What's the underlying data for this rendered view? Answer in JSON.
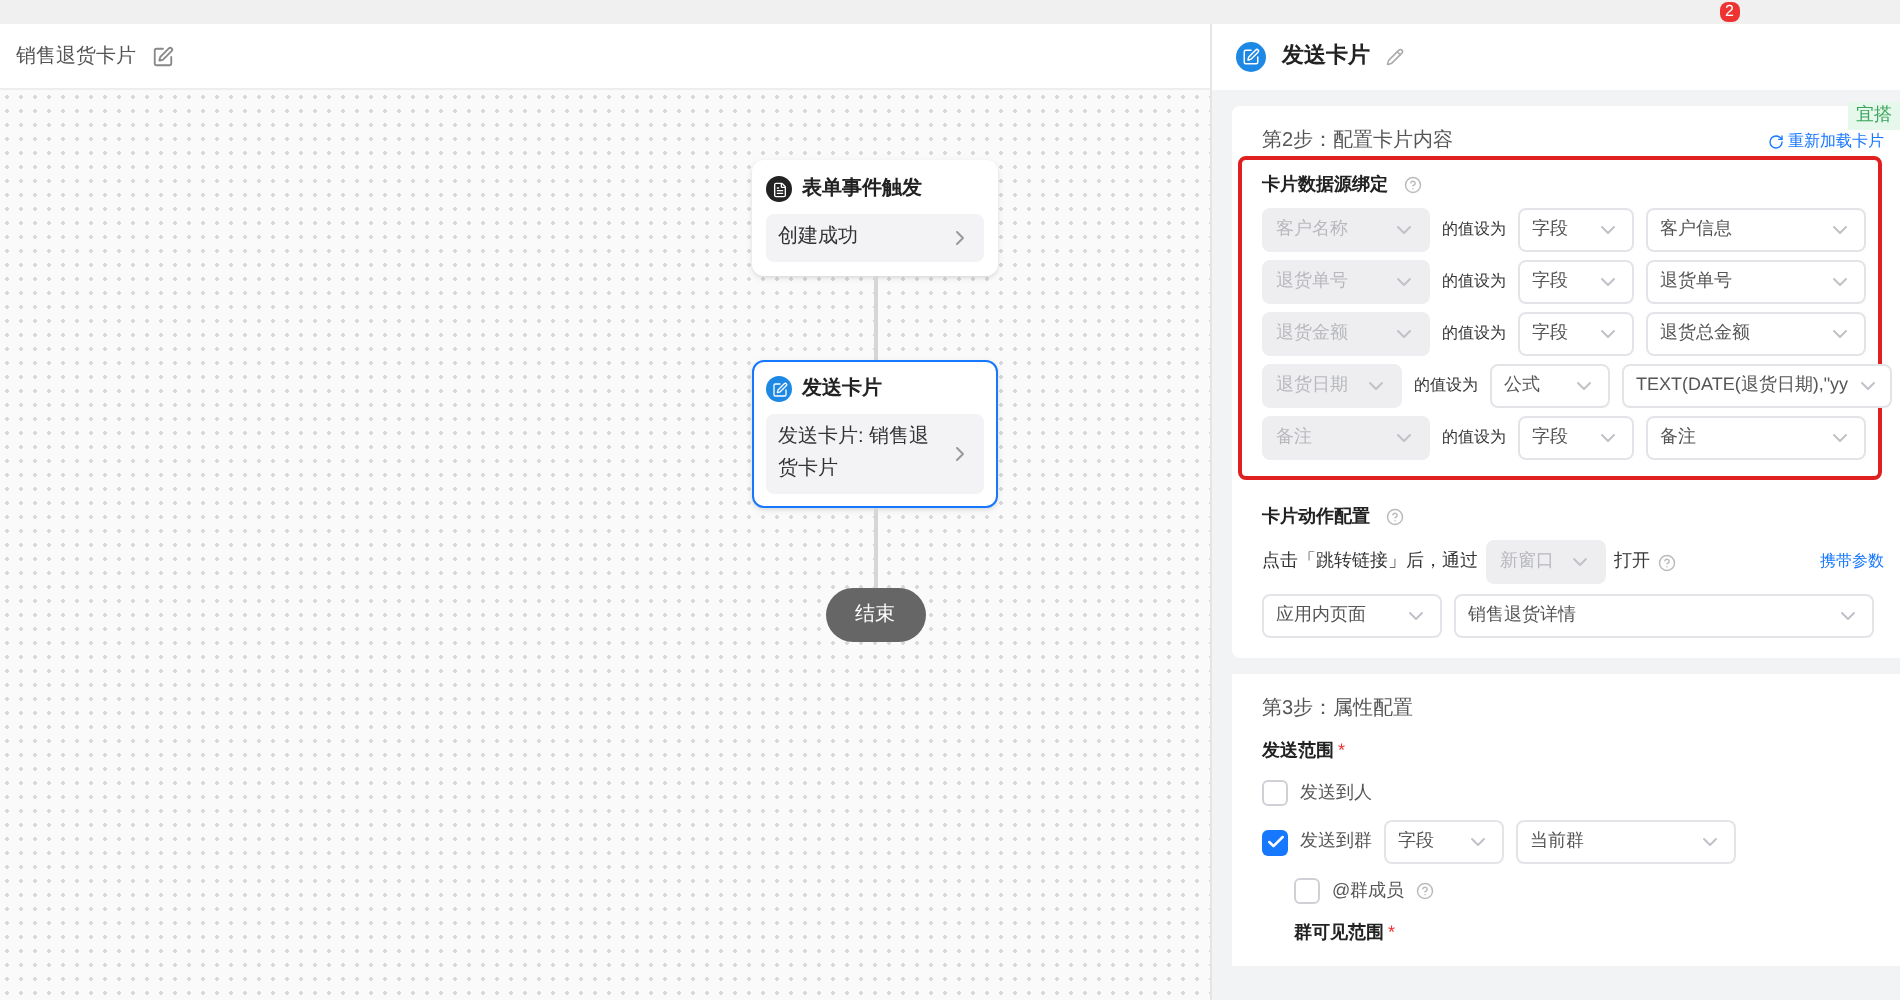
{
  "top_bar": {
    "badge": "2"
  },
  "flow": {
    "title": "销售退货卡片",
    "nodes": [
      {
        "kind": "trigger",
        "title": "表单事件触发",
        "detail": "创建成功",
        "selected": false
      },
      {
        "kind": "card",
        "title": "发送卡片",
        "detail": "发送卡片: 销售退货卡片",
        "selected": true
      }
    ],
    "end": "结束"
  },
  "panel": {
    "title": "发送卡片",
    "step2": {
      "tag": "宜搭",
      "title": "第2步：配置卡片内容",
      "reload": "重新加载卡片",
      "binding_title": "卡片数据源绑定",
      "rows": [
        {
          "kind": "field",
          "source": "客户名称",
          "verb": "的值设为",
          "type": "字段",
          "value": "客户信息"
        },
        {
          "kind": "field",
          "source": "退货单号",
          "verb": "的值设为",
          "type": "字段",
          "value": "退货单号"
        },
        {
          "kind": "field",
          "source": "退货金额",
          "verb": "的值设为",
          "type": "字段",
          "value": "退货总金额"
        },
        {
          "kind": "formula",
          "source": "退货日期",
          "verb": "的值设为",
          "type": "公式",
          "value": "TEXT(DATE(退货日期),\"yy"
        },
        {
          "kind": "field",
          "source": "备注",
          "verb": "的值设为",
          "type": "字段",
          "value": "备注"
        }
      ],
      "action_title": "卡片动作配置",
      "action_prefix": "点击「跳转链接」后，通过",
      "open_mode": "新窗口",
      "action_suffix": "打开",
      "params_link": "携带参数",
      "page_type": "应用内页面",
      "page": "销售退货详情"
    },
    "step3": {
      "title": "第3步：属性配置",
      "scope_label": "发送范围",
      "required": "*",
      "options": [
        {
          "label": "发送到人",
          "checked": false
        },
        {
          "label": "发送到群",
          "checked": true,
          "type": "字段",
          "value": "当前群"
        }
      ],
      "mention": {
        "label": "@群成员",
        "checked": false
      },
      "visible_label": "群可见范围"
    }
  }
}
